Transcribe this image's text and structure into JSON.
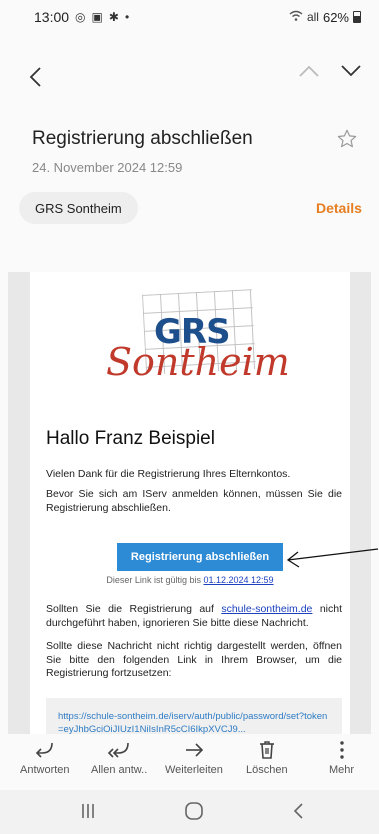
{
  "status_bar": {
    "time": "13:00",
    "icons_left": [
      "whatsapp-icon",
      "gallery-icon",
      "settings-icon"
    ],
    "dot": "•",
    "signal_text": "all",
    "battery": "62%"
  },
  "header": {
    "subject": "Registrierung abschließen",
    "date": "24. November 2024  12:59",
    "sender": "GRS Sontheim",
    "details_label": "Details"
  },
  "email": {
    "logo_text_top": "GRS",
    "logo_text_bottom": "Sontheim",
    "greeting": "Hallo Franz Beispiel",
    "para1": "Vielen Dank für die Registrierung Ihres Elternkontos.",
    "para2": "Bevor Sie sich am IServ anmelden können, müssen Sie die Registrierung abschließen.",
    "button_label": "Registrierung abschließen",
    "valid_text": "Dieser Link ist gültig bis",
    "valid_date": "01.12.2024 12:59",
    "para3_before": "Sollten Sie die Registrierung auf",
    "para3_link": "schule-sontheim.de",
    "para3_after": "nicht durchgeführt haben, ignorieren Sie bitte diese Nachricht.",
    "para4": "Sollte diese Nachricht nicht richtig dargestellt werden, öffnen Sie bitte den folgenden Link in Ihrem Browser, um die Registrierung fortzusetzen:",
    "link_url": "https://schule-sontheim.de/iserv/auth/public/password/set?token=eyJhbGciOiJIUzI1NiIsInR5cCI6IkpXVCJ9..."
  },
  "toolbar": {
    "reply": "Antworten",
    "reply_all": "Allen antw..",
    "forward": "Weiterleiten",
    "delete": "Löschen",
    "more": "Mehr"
  },
  "colors": {
    "accent": "#e67e22",
    "button": "#2d8ad4",
    "link": "#1a3fbf"
  }
}
